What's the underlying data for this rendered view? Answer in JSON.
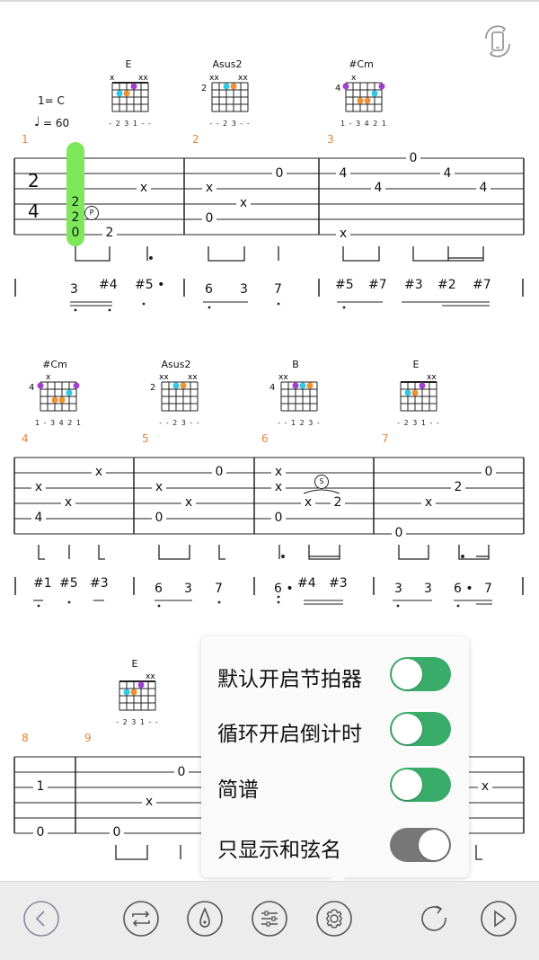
{
  "score": {
    "key": "1= C",
    "tempo": "= 60",
    "time_signature": {
      "top": "2",
      "bottom": "4"
    },
    "systems": [
      {
        "chords": [
          {
            "name": "E",
            "fingering": "- 2 3 1 - -",
            "fret": ""
          },
          {
            "name": "Asus2",
            "fingering": "- - 2 3 - -",
            "fret": "2"
          },
          {
            "name": "#Cm",
            "fingering": "1 - 3 4 2 1",
            "fret": "4"
          }
        ],
        "bars": [
          "1",
          "2",
          "3"
        ],
        "tab_numbers": [
          "2",
          "2",
          "0",
          "2",
          "x",
          "x",
          "0",
          "x",
          "0",
          "x",
          "4",
          "0",
          "4",
          "4",
          "4"
        ],
        "slide_mark": "P",
        "jianpu": [
          "3",
          "#4",
          "#5 •",
          "6",
          "3",
          "7",
          "#5",
          "#7",
          "#3",
          "#2",
          "#7"
        ]
      },
      {
        "chords": [
          {
            "name": "#Cm",
            "fingering": "1 - 3 4 2 1",
            "fret": "4"
          },
          {
            "name": "Asus2",
            "fingering": "- - 2 3 - -",
            "fret": "2"
          },
          {
            "name": "B",
            "fingering": "- - 1 2 3 -",
            "fret": "4"
          },
          {
            "name": "E",
            "fingering": "- 2 3 1 - -",
            "fret": ""
          }
        ],
        "bars": [
          "4",
          "5",
          "6",
          "7"
        ],
        "tab_numbers": [
          "x",
          "x",
          "x",
          "4",
          "0",
          "x",
          "x",
          "0",
          "x",
          "x",
          "x",
          "2",
          "0",
          "0",
          "2",
          "x",
          "0"
        ],
        "slide_mark": "S",
        "jianpu": [
          "#1",
          "#5",
          "#3",
          "6",
          "3",
          "7",
          "6 •",
          "#4",
          "#3",
          "3",
          "3",
          "6 •",
          "7"
        ]
      },
      {
        "chords": [
          {
            "name": "E",
            "fingering": "- 2 3 1 - -",
            "fret": ""
          }
        ],
        "bars": [
          "8",
          "9"
        ],
        "tab_numbers": [
          "1",
          "0",
          "0",
          "x",
          "0",
          "x"
        ]
      }
    ]
  },
  "settings_popup": {
    "items": [
      {
        "label": "默认开启节拍器",
        "state": "on"
      },
      {
        "label": "循环开启倒计时",
        "state": "on"
      },
      {
        "label": "简谱",
        "state": "on"
      },
      {
        "label": "只显示和弦名",
        "state": "off"
      }
    ]
  },
  "toolbar": {
    "buttons": [
      "back-icon",
      "loop-icon",
      "metronome-icon",
      "mixer-icon",
      "settings-icon",
      "replay-icon",
      "play-icon"
    ]
  },
  "colors": {
    "accent_green": "#3aac6a",
    "toggle_off": "#777777",
    "bar_number": "#e8833a",
    "playhead": "#7ee85a",
    "finger_purple": "#a040d0",
    "finger_cyan": "#30c8e8",
    "finger_orange": "#f09030"
  }
}
